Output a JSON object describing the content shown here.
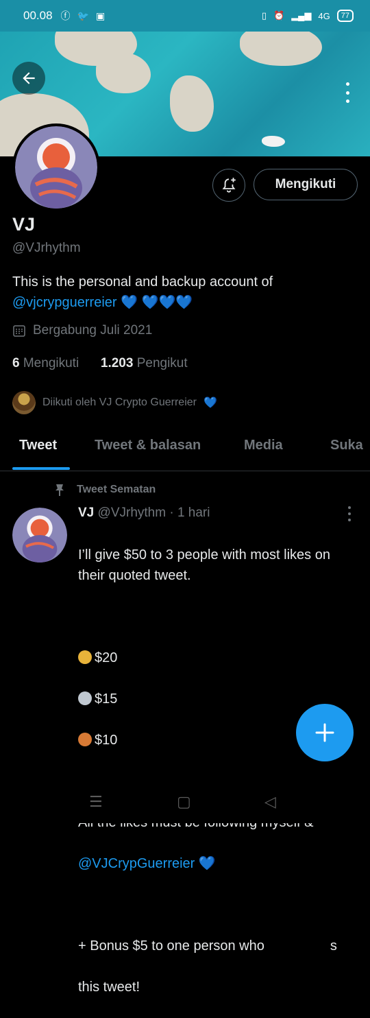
{
  "status_bar": {
    "time": "00.08",
    "network": "4G",
    "battery": "77"
  },
  "header": {
    "back_icon": "arrow-left-icon",
    "more_icon": "more-vertical-icon"
  },
  "profile": {
    "follow_button": "Mengikuti",
    "name": "VJ",
    "handle": "@VJrhythm",
    "bio_text": "This is the personal and backup account of",
    "bio_mention": "@vjcrypguerreier",
    "bio_hearts_1": "💙",
    "bio_hearts_2": "💙💙💙",
    "joined": "Bergabung Juli 2021",
    "following_count": "6",
    "following_label": "Mengikuti",
    "followers_count": "1.203",
    "followers_label": "Pengikut",
    "followed_by": "Diikuti oleh VJ Crypto Guerreier",
    "followed_by_heart": "💙"
  },
  "tabs": [
    {
      "label": "Tweet"
    },
    {
      "label": "Tweet & balasan"
    },
    {
      "label": "Media"
    },
    {
      "label": "Suka"
    }
  ],
  "tweet": {
    "pinned_label": "Tweet Sematan",
    "author_name": "VJ",
    "author_handle": "@VJrhythm",
    "time": "· 1 hari",
    "line1": "I’ll give $50 to 3 people with most likes on their quoted tweet.",
    "prize1": "$20",
    "prize2": "$15",
    "prize3": "$10",
    "line2": "All the likes must be following myself &",
    "mention": "@VJCrypGuerreier",
    "line3": "+ Bonus $5 to one person who",
    "line3_end": "s",
    "line4": "this tweet!"
  },
  "colors": {
    "accent": "#1d9bf0",
    "status_bar": "#1a8fa6"
  }
}
